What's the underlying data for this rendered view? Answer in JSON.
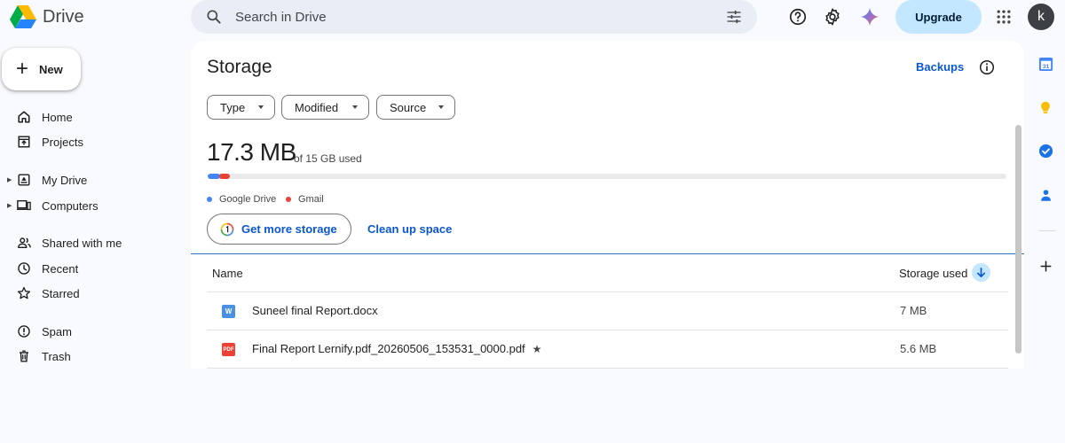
{
  "app": {
    "name": "Drive"
  },
  "search": {
    "placeholder": "Search in Drive"
  },
  "header": {
    "upgrade_label": "Upgrade",
    "avatar_letter": "k"
  },
  "new_button": {
    "label": "New"
  },
  "nav": {
    "items": [
      {
        "label": "Home",
        "icon": "home-icon"
      },
      {
        "label": "Projects",
        "icon": "projects-icon"
      },
      {
        "label": "My Drive",
        "icon": "my-drive-icon"
      },
      {
        "label": "Computers",
        "icon": "computers-icon"
      },
      {
        "label": "Shared with me",
        "icon": "shared-icon"
      },
      {
        "label": "Recent",
        "icon": "clock-icon"
      },
      {
        "label": "Starred",
        "icon": "star-icon"
      },
      {
        "label": "Spam",
        "icon": "spam-icon"
      },
      {
        "label": "Trash",
        "icon": "trash-icon"
      }
    ]
  },
  "storage": {
    "title": "Storage",
    "backups_label": "Backups",
    "filters": [
      "Type",
      "Modified",
      "Source"
    ],
    "used_amount": "17.3 MB",
    "used_total": "of 15 GB used",
    "legend": [
      {
        "label": "Google Drive",
        "color": "#4285f4"
      },
      {
        "label": "Gmail",
        "color": "#ea4335"
      }
    ],
    "get_more_label": "Get more storage",
    "cleanup_label": "Clean up space"
  },
  "table": {
    "col_name": "Name",
    "col_storage": "Storage used",
    "rows": [
      {
        "name": "Suneel final Report.docx",
        "size": "7 MB",
        "type": "word",
        "icon_text": "W",
        "starred": false
      },
      {
        "name": "Final Report Lernify.pdf_20260506_153531_0000.pdf",
        "size": "5.6 MB",
        "type": "pdf",
        "icon_text": "PDF",
        "starred": true
      }
    ]
  },
  "colors": {
    "accent": "#0b57d0",
    "upgrade_bg": "#c2e7ff",
    "word": "#4a90e2",
    "pdf": "#ea4335"
  }
}
